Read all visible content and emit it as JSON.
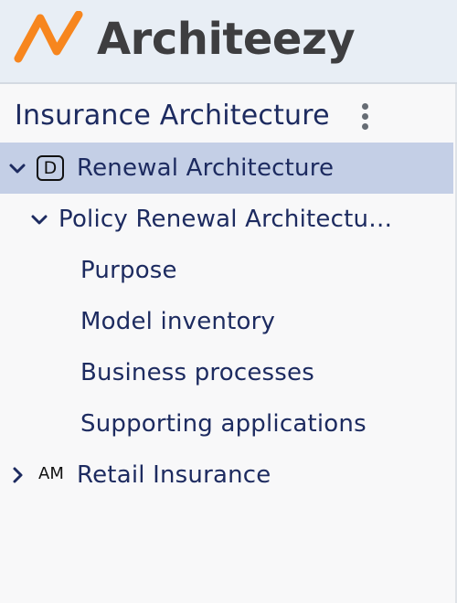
{
  "brand": {
    "name": "Architeezy",
    "accent": "#f7861e",
    "text_color": "#3e3e40"
  },
  "sidebar": {
    "workspace_title": "Insurance Architecture",
    "menu_icon": "more-vert-icon",
    "tree": {
      "renewal": {
        "label": "Renewal Architecture",
        "badge": "D",
        "expanded": true,
        "selected": true
      },
      "policy": {
        "label": "Policy Renewal Architectu…",
        "expanded": true
      },
      "children": [
        {
          "label": "Purpose"
        },
        {
          "label": "Model inventory"
        },
        {
          "label": "Business processes"
        },
        {
          "label": "Supporting applications"
        }
      ],
      "retail": {
        "label": "Retail Insurance",
        "badge": "AM",
        "expanded": false
      }
    }
  }
}
